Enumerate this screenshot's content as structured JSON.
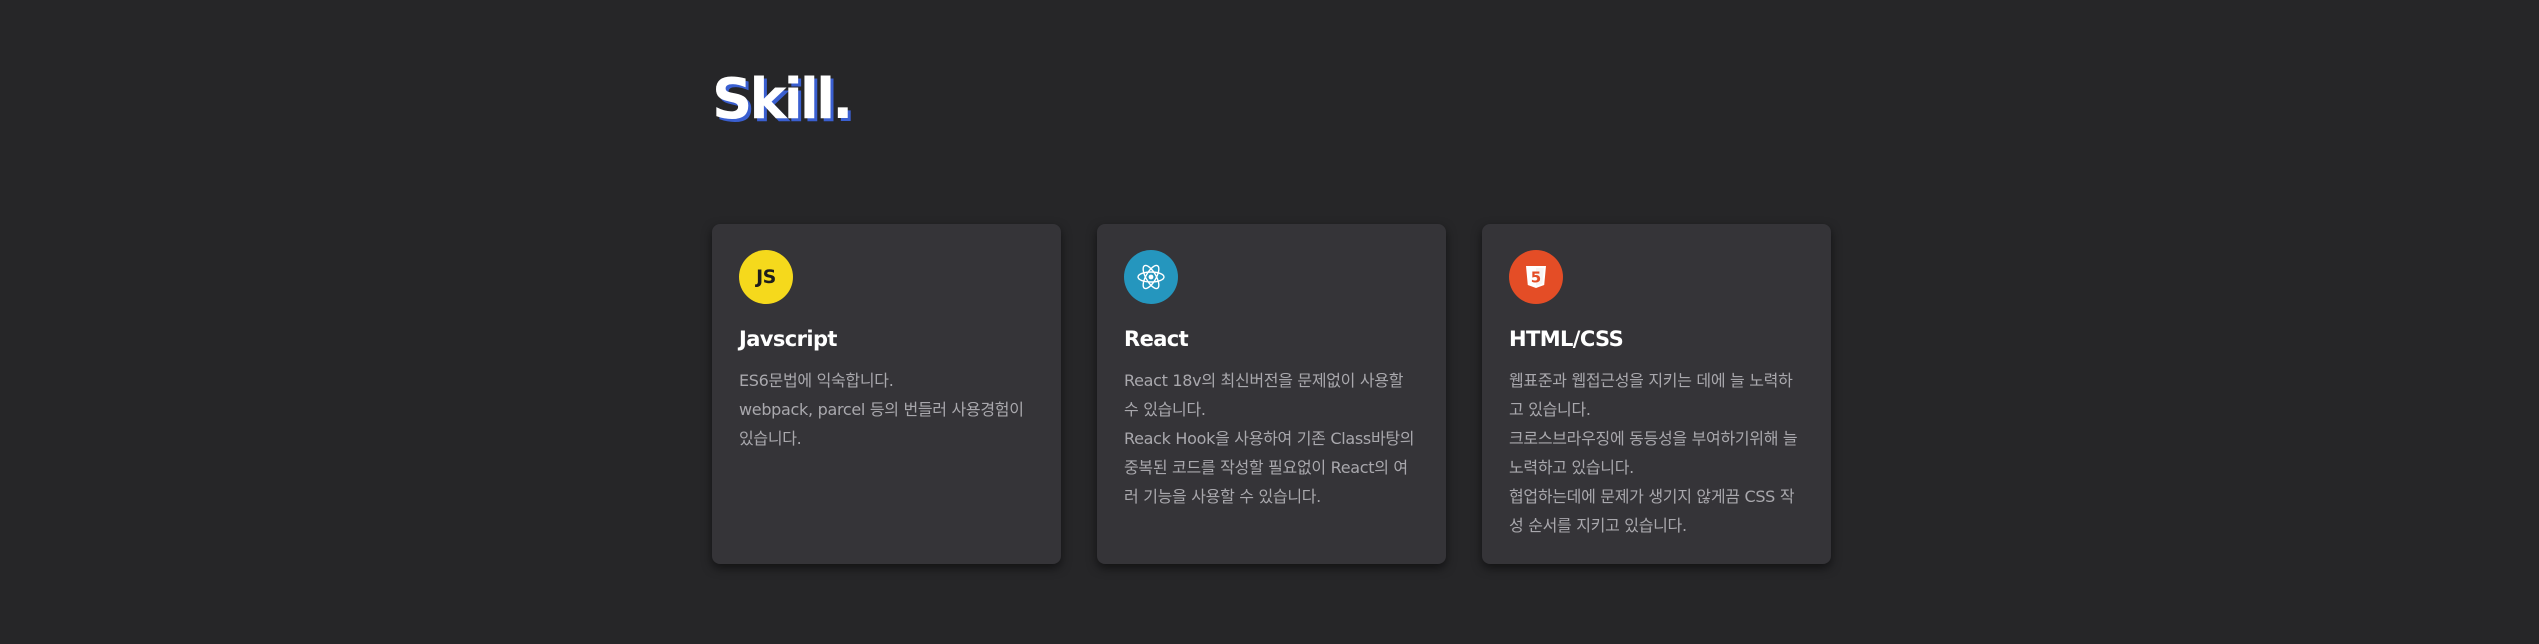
{
  "section": {
    "title": "Skill."
  },
  "colors": {
    "background": "#262628",
    "card": "#353438",
    "title_shadow": "#3a5fd0",
    "js_badge": "#f5d91c",
    "react_badge": "#2596be",
    "html_badge": "#e44d26"
  },
  "skills": [
    {
      "icon": "javascript-logo-icon",
      "badge_text": "JS",
      "name": "Javscript",
      "lines": [
        "ES6문법에 익숙합니다.",
        "webpack, parcel 등의 번들러 사용경험이 있습니다."
      ]
    },
    {
      "icon": "react-logo-icon",
      "name": "React",
      "lines": [
        "React 18v의 최신버전을 문제없이 사용할 수 있습니다.",
        "Reack Hook을 사용하여 기존 Class바탕의 중복된 코드를 작성할 필요없이 React의 여러 기능을 사용할 수 있습니다."
      ]
    },
    {
      "icon": "html5-logo-icon",
      "badge_text": "5",
      "name": "HTML/CSS",
      "lines": [
        "웹표준과 웹접근성을 지키는 데에 늘 노력하고 있습니다.",
        "크로스브라우징에 동등성을 부여하기위해 늘 노력하고 있습니다.",
        "협업하는데에 문제가 생기지 않게끔 CSS 작성 순서를 지키고 있습니다."
      ]
    }
  ]
}
